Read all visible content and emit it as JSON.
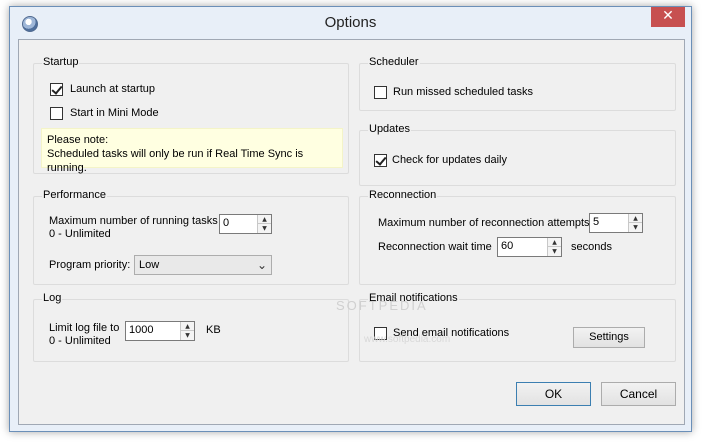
{
  "window": {
    "title": "Options",
    "close_glyph": "✕"
  },
  "startup": {
    "title": "Startup",
    "launch_at_startup": {
      "label": "Launch at startup",
      "checked": true
    },
    "mini_mode": {
      "label": "Start in Mini Mode",
      "checked": false
    },
    "note_line1": "Please note:",
    "note_line2": "Scheduled tasks will only be run if Real Time Sync is running."
  },
  "scheduler": {
    "title": "Scheduler",
    "run_missed": {
      "label": "Run missed scheduled tasks",
      "checked": false
    }
  },
  "updates": {
    "title": "Updates",
    "check_daily": {
      "label": "Check for updates daily",
      "checked": true
    }
  },
  "performance": {
    "title": "Performance",
    "max_tasks_label": "Maximum number of running tasks",
    "max_tasks_hint": "0 - Unlimited",
    "max_tasks_value": "0",
    "priority_label": "Program priority:",
    "priority_value": "Low"
  },
  "reconnection": {
    "title": "Reconnection",
    "max_attempts_label": "Maximum number of reconnection attempts",
    "max_attempts_value": "5",
    "wait_label": "Reconnection wait time",
    "wait_value": "60",
    "wait_unit": "seconds"
  },
  "log": {
    "title": "Log",
    "limit_label": "Limit log file to",
    "limit_hint": "0 - Unlimited",
    "limit_value": "1000",
    "limit_unit": "KB"
  },
  "email": {
    "title": "Email notifications",
    "send": {
      "label": "Send email notifications",
      "checked": false
    },
    "settings_label": "Settings"
  },
  "buttons": {
    "ok": "OK",
    "cancel": "Cancel"
  },
  "watermark": {
    "line1": "SOFTPEDIA",
    "line2": "www.softpedia.com"
  },
  "icons": {
    "app": "globe-app-icon",
    "spin_up": "▲",
    "spin_down": "▼",
    "combo_arrow": "⌄"
  },
  "colors": {
    "accent_border": "#3c7fb1",
    "note_bg": "#ffffe1",
    "close_bg": "#c75050"
  }
}
